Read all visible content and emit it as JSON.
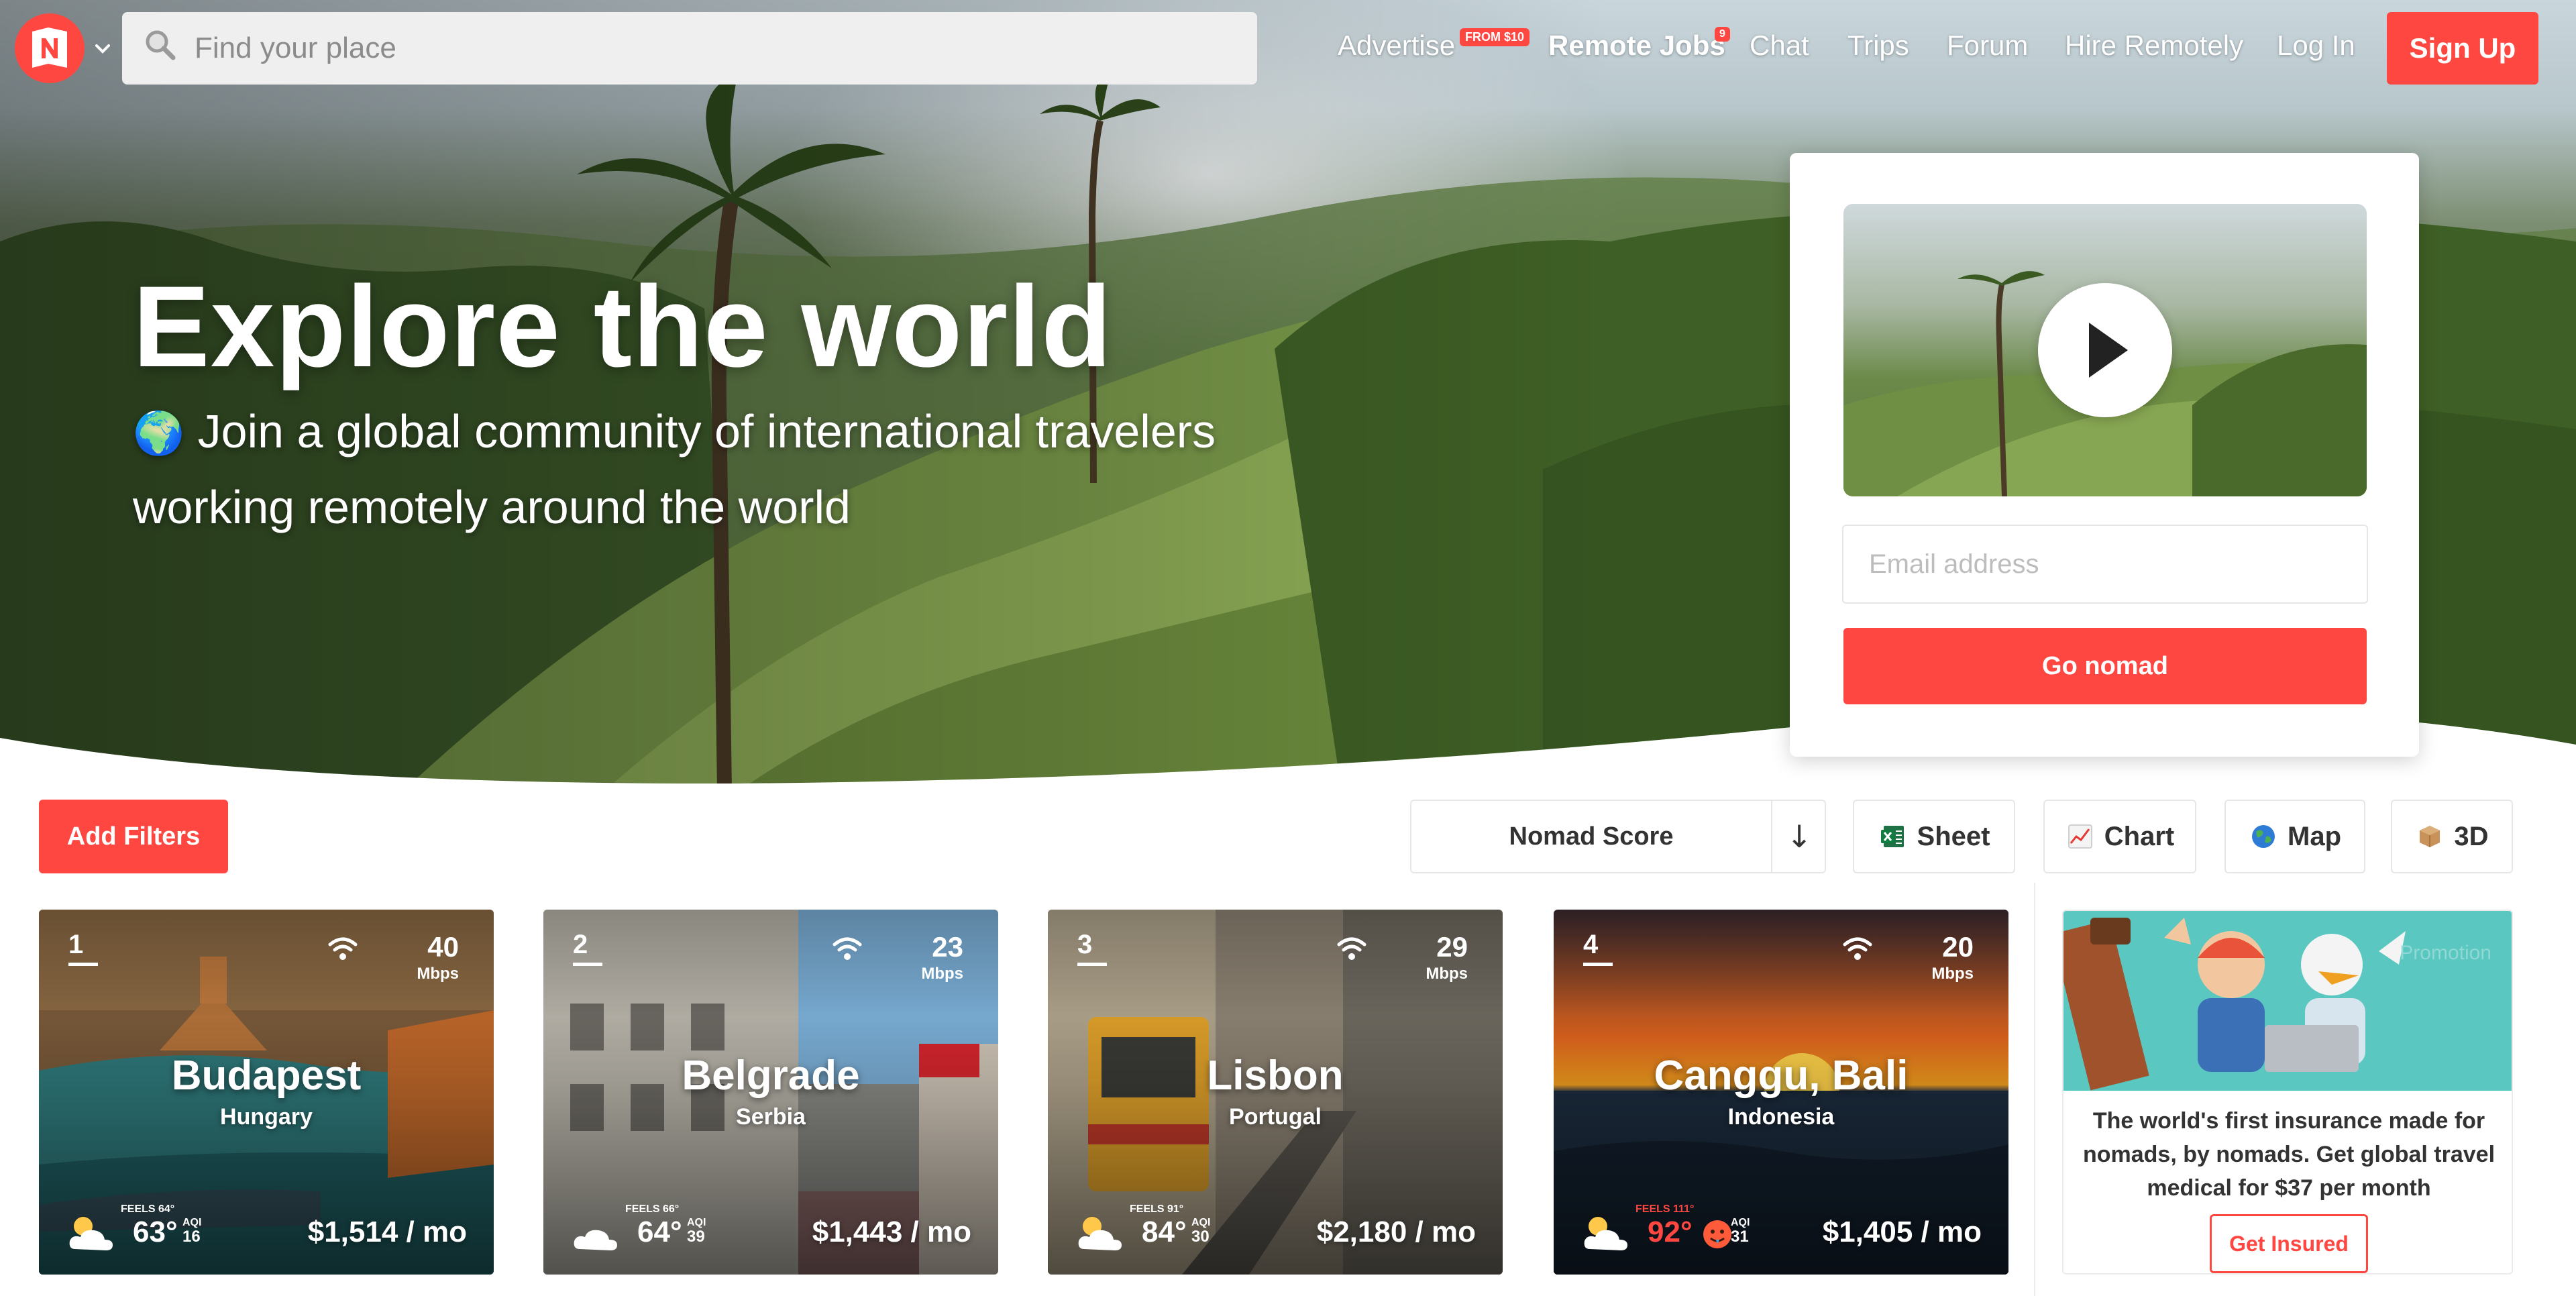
{
  "nav": {
    "search_placeholder": "Find your place",
    "links": {
      "advertise": "Advertise",
      "advertise_badge": "FROM $10",
      "remote_jobs": "Remote Jobs",
      "remote_jobs_badge": "9",
      "chat": "Chat",
      "trips": "Trips",
      "forum": "Forum",
      "hire": "Hire Remotely",
      "login": "Log In"
    },
    "signup_label": "Sign Up"
  },
  "hero": {
    "title": "Explore the world",
    "subtitle_emoji": "🌍",
    "subtitle": "Join a global community of international travelers working remotely around the world"
  },
  "signup_card": {
    "email_placeholder": "Email address",
    "button_label": "Go nomad"
  },
  "toolbar": {
    "add_filters": "Add Filters",
    "sort_label": "Nomad Score",
    "sort_direction": "↓",
    "views": {
      "sheet": "Sheet",
      "chart": "Chart",
      "map": "Map",
      "threed": "3D"
    }
  },
  "cities": [
    {
      "rank": "1",
      "name": "Budapest",
      "country": "Hungary",
      "internet": "40",
      "internet_unit": "Mbps",
      "feels": "FEELS 64°",
      "temp": "63°",
      "aqi_label": "AQI",
      "aqi": "16",
      "cost": "$1,514 / mo"
    },
    {
      "rank": "2",
      "name": "Belgrade",
      "country": "Serbia",
      "internet": "23",
      "internet_unit": "Mbps",
      "feels": "FEELS 66°",
      "temp": "64°",
      "aqi_label": "AQI",
      "aqi": "39",
      "cost": "$1,443 / mo"
    },
    {
      "rank": "3",
      "name": "Lisbon",
      "country": "Portugal",
      "internet": "29",
      "internet_unit": "Mbps",
      "feels": "FEELS 91°",
      "temp": "84°",
      "aqi_label": "AQI",
      "aqi": "30",
      "cost": "$2,180 / mo"
    },
    {
      "rank": "4",
      "name": "Canggu, Bali",
      "country": "Indonesia",
      "internet": "20",
      "internet_unit": "Mbps",
      "feels": "FEELS 111°",
      "temp": "92°",
      "aqi_label": "AQI",
      "aqi": "31",
      "cost": "$1,405 / mo"
    }
  ],
  "promo": {
    "tag": "Promotion",
    "text": "The world's first insurance made for nomads, by nomads. Get global travel medical for $37 per month",
    "button": "Get Insured"
  },
  "colors": {
    "brand_red": "#ff4742",
    "promo_teal": "#5bc7c1"
  }
}
